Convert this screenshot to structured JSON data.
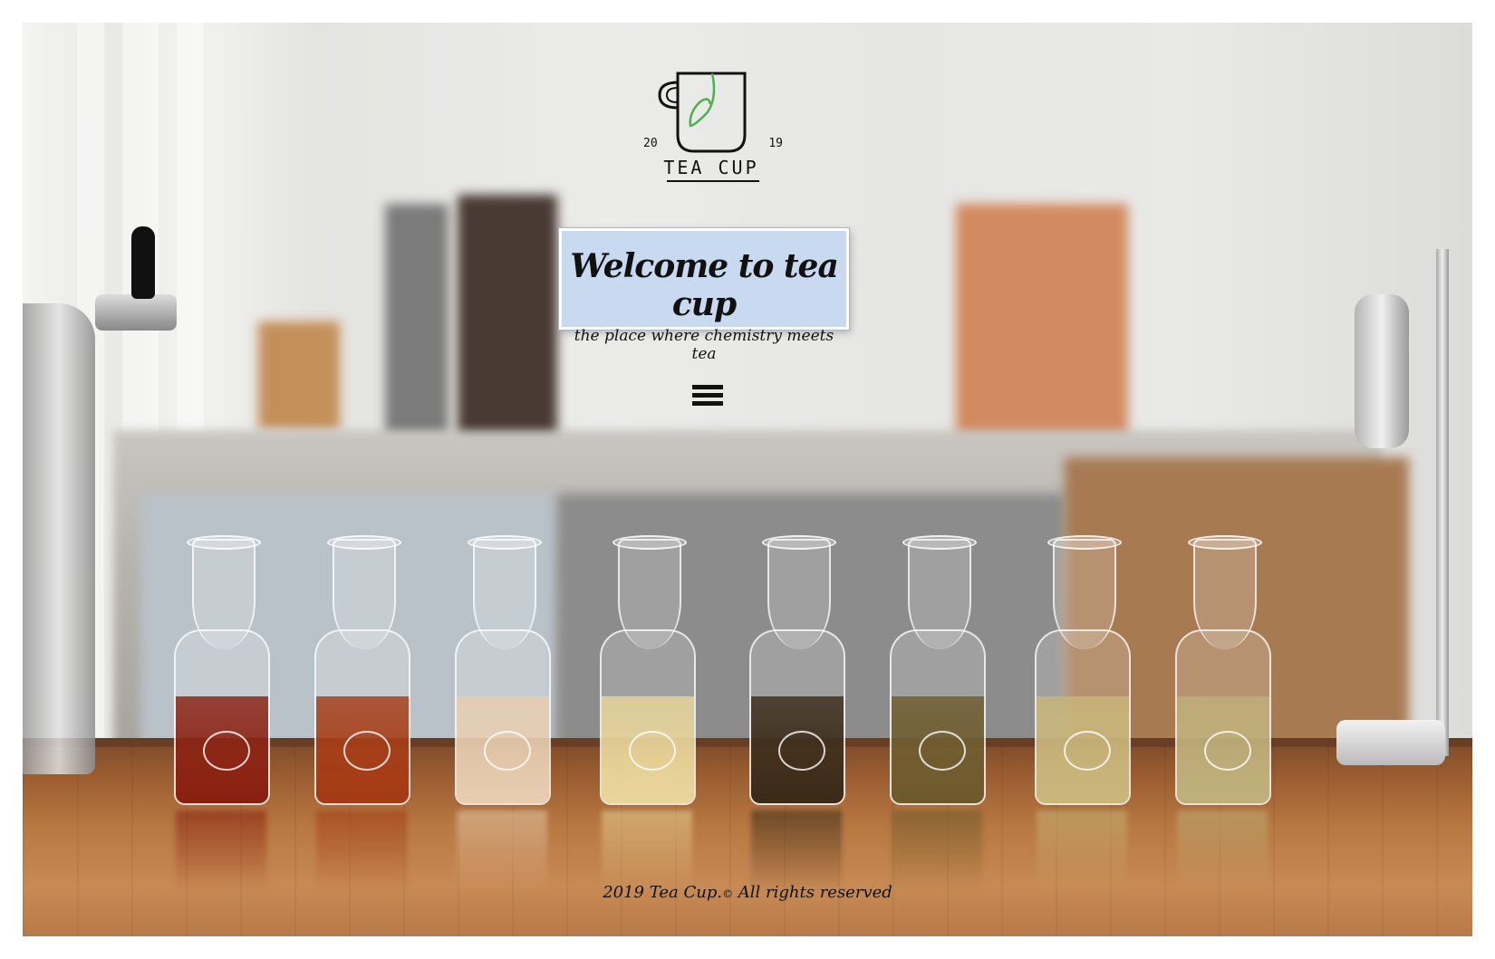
{
  "brand": {
    "logo_text": "TEA CUP",
    "year_left": "20",
    "year_right": "19",
    "logo_leaf_color": "#4caf50"
  },
  "hero": {
    "title": "Welcome to tea cup",
    "subtitle": "the place where chemistry meets tea",
    "box_color": "#c9daf0"
  },
  "menu": {
    "icon": "hamburger-menu-icon"
  },
  "footer": {
    "text_before": "2019 Tea Cup.",
    "copyright_symbol": "©",
    "text_after": " All rights reserved"
  },
  "carafe_colors": [
    "#8a1f10",
    "#a53a14",
    "#e8cdb0",
    "#e9d69a",
    "#3a2a18",
    "#6d5a2c",
    "#c9b77a",
    "#bfb07a"
  ]
}
